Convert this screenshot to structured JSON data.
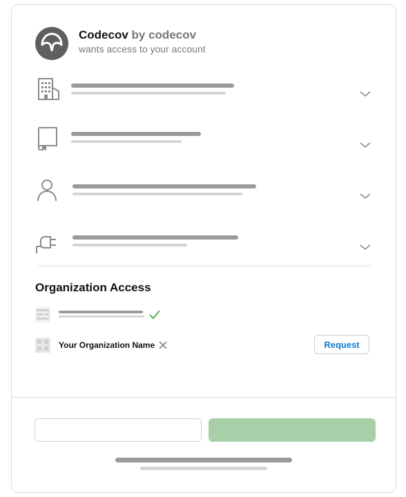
{
  "header": {
    "app_name": "Codecov",
    "owner_text": "by codecov",
    "subtitle": "wants access to your account",
    "logo_icon": "codecov-umbrella-logo"
  },
  "permissions": [
    {
      "icon": "building-icon",
      "expanded": false
    },
    {
      "icon": "book-icon",
      "expanded": false
    },
    {
      "icon": "person-icon",
      "expanded": false
    },
    {
      "icon": "plug-icon",
      "expanded": false
    }
  ],
  "organization_access": {
    "heading": "Organization Access",
    "orgs": [
      {
        "icon": "org-avatar-icon",
        "status": "granted",
        "status_icon": "check-icon"
      },
      {
        "icon": "org-avatar-icon",
        "name": "Your Organization Name",
        "status_icon": "x-icon",
        "action_label": "Request"
      }
    ]
  },
  "colors": {
    "accent_link": "#0a7bd6",
    "authorize_green": "#a8d0a8",
    "check_green": "#4caf50"
  }
}
